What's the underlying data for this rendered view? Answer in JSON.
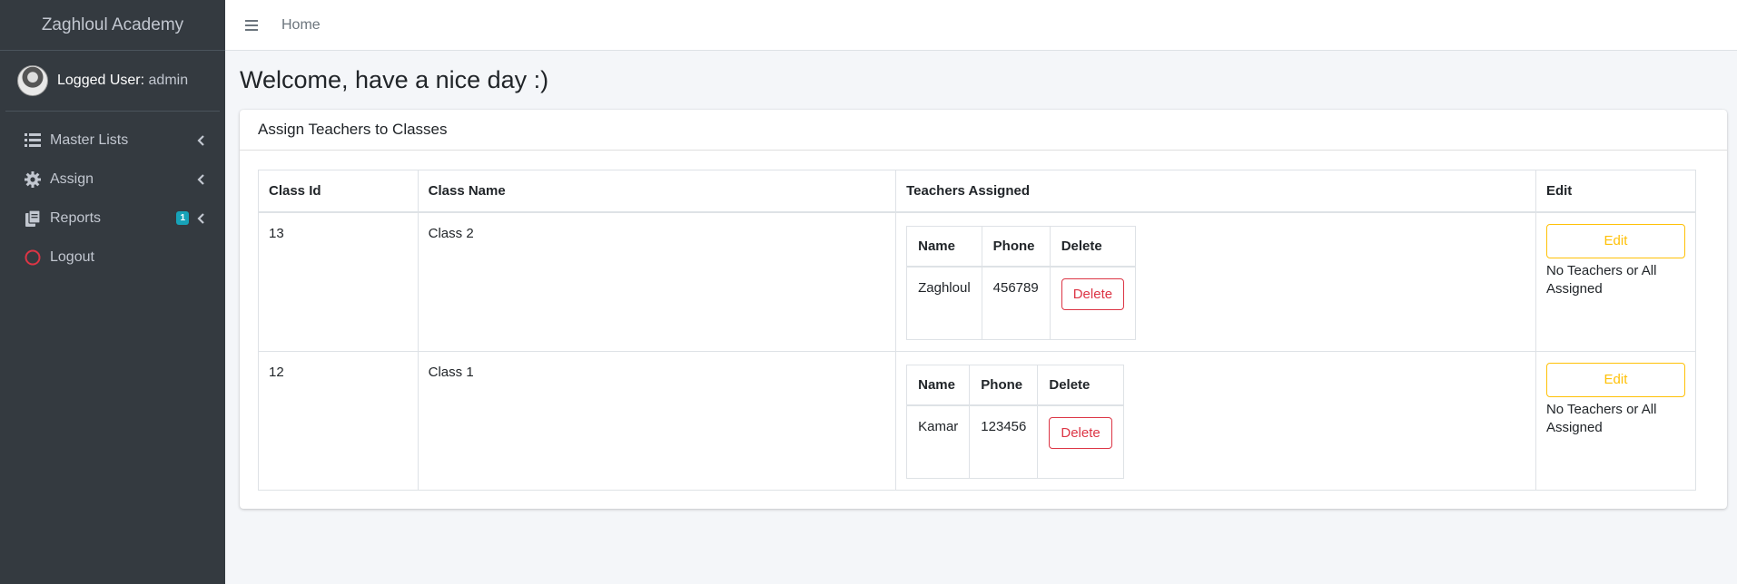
{
  "brand": "Zaghloul Academy",
  "user": {
    "prefix": "Logged User:",
    "name": "admin"
  },
  "nav": [
    {
      "label": "Master Lists",
      "icon": "list-icon",
      "has_chevron": true
    },
    {
      "label": "Assign",
      "icon": "gear-icon",
      "has_chevron": true
    },
    {
      "label": "Reports",
      "icon": "copy-icon",
      "badge": "1",
      "has_chevron": true
    },
    {
      "label": "Logout",
      "icon": "circle-icon",
      "icon_color": "#dc3545",
      "has_chevron": false
    }
  ],
  "topbar": {
    "home": "Home"
  },
  "welcome": "Welcome, have a nice day :)",
  "card": {
    "title": "Assign Teachers to Classes",
    "columns": [
      "Class Id",
      "Class Name",
      "Teachers Assigned",
      "Edit"
    ],
    "inner_columns": [
      "Name",
      "Phone",
      "Delete"
    ],
    "rows": [
      {
        "id": "13",
        "name": "Class 2",
        "teachers": [
          {
            "name": "Zaghloul",
            "phone": "456789",
            "delete_label": "Delete"
          }
        ],
        "edit_label": "Edit",
        "note": "No Teachers or All Assigned"
      },
      {
        "id": "12",
        "name": "Class 1",
        "teachers": [
          {
            "name": "Kamar",
            "phone": "123456",
            "delete_label": "Delete"
          }
        ],
        "edit_label": "Edit",
        "note": "No Teachers or All Assigned"
      }
    ]
  },
  "colors": {
    "sidebar": "#343a40",
    "edit": "#ffc107",
    "delete": "#dc3545",
    "badge": "#17a2b8"
  }
}
